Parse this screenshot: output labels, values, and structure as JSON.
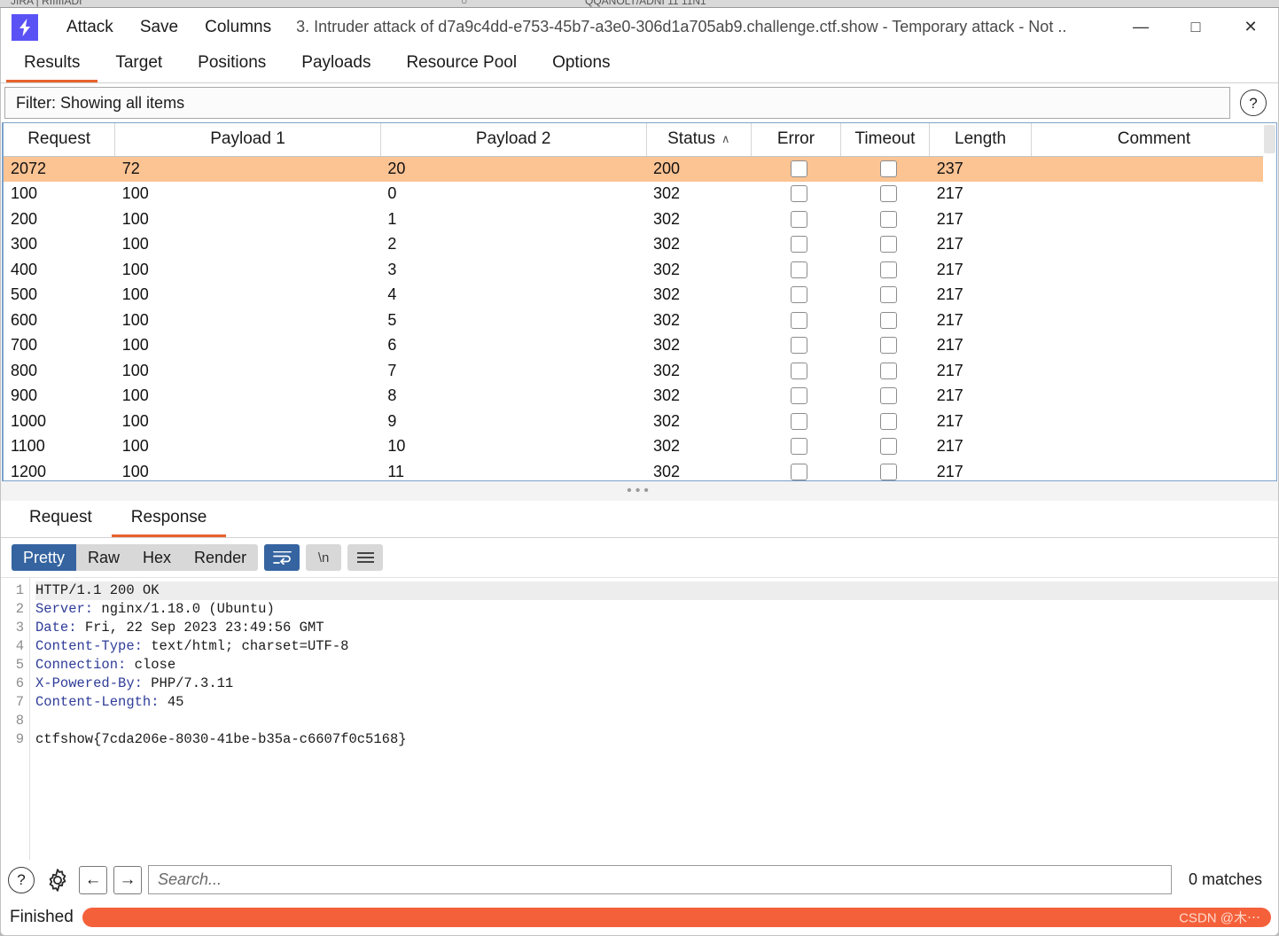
{
  "window": {
    "logo_icon": "lightning-bolt-icon",
    "title": "3. Intruder attack of d7a9c4dd-e753-45b7-a3e0-306d1a705ab9.challenge.ctf.show - Temporary attack - Not ..",
    "menu": [
      "Attack",
      "Save",
      "Columns"
    ],
    "controls": {
      "minimize": "—",
      "maximize": "□",
      "close": "✕"
    },
    "accent_orange": "#e8622c",
    "logo_color": "#5b52f5",
    "selected_row_color": "#fcc393",
    "progress_color": "#f4603a"
  },
  "top_tabs": [
    {
      "label": "Results",
      "active": true
    },
    {
      "label": "Target",
      "active": false
    },
    {
      "label": "Positions",
      "active": false
    },
    {
      "label": "Payloads",
      "active": false
    },
    {
      "label": "Resource Pool",
      "active": false
    },
    {
      "label": "Options",
      "active": false
    }
  ],
  "filter": {
    "text": "Filter: Showing all items",
    "help_icon": "question-mark-icon"
  },
  "results_table": {
    "columns": [
      "Request",
      "Payload 1",
      "Payload 2",
      "Status",
      "Error",
      "Timeout",
      "Length",
      "Comment"
    ],
    "sorted_column": "Status",
    "sort_direction": "ascending",
    "sort_glyph": "∧",
    "rows": [
      {
        "request": "2072",
        "payload1": "72",
        "payload2": "20",
        "status": "200",
        "error": false,
        "timeout": false,
        "length": "237",
        "comment": "",
        "selected": true
      },
      {
        "request": "100",
        "payload1": "100",
        "payload2": "0",
        "status": "302",
        "error": false,
        "timeout": false,
        "length": "217",
        "comment": "",
        "selected": false
      },
      {
        "request": "200",
        "payload1": "100",
        "payload2": "1",
        "status": "302",
        "error": false,
        "timeout": false,
        "length": "217",
        "comment": "",
        "selected": false
      },
      {
        "request": "300",
        "payload1": "100",
        "payload2": "2",
        "status": "302",
        "error": false,
        "timeout": false,
        "length": "217",
        "comment": "",
        "selected": false
      },
      {
        "request": "400",
        "payload1": "100",
        "payload2": "3",
        "status": "302",
        "error": false,
        "timeout": false,
        "length": "217",
        "comment": "",
        "selected": false
      },
      {
        "request": "500",
        "payload1": "100",
        "payload2": "4",
        "status": "302",
        "error": false,
        "timeout": false,
        "length": "217",
        "comment": "",
        "selected": false
      },
      {
        "request": "600",
        "payload1": "100",
        "payload2": "5",
        "status": "302",
        "error": false,
        "timeout": false,
        "length": "217",
        "comment": "",
        "selected": false
      },
      {
        "request": "700",
        "payload1": "100",
        "payload2": "6",
        "status": "302",
        "error": false,
        "timeout": false,
        "length": "217",
        "comment": "",
        "selected": false
      },
      {
        "request": "800",
        "payload1": "100",
        "payload2": "7",
        "status": "302",
        "error": false,
        "timeout": false,
        "length": "217",
        "comment": "",
        "selected": false
      },
      {
        "request": "900",
        "payload1": "100",
        "payload2": "8",
        "status": "302",
        "error": false,
        "timeout": false,
        "length": "217",
        "comment": "",
        "selected": false
      },
      {
        "request": "1000",
        "payload1": "100",
        "payload2": "9",
        "status": "302",
        "error": false,
        "timeout": false,
        "length": "217",
        "comment": "",
        "selected": false
      },
      {
        "request": "1100",
        "payload1": "100",
        "payload2": "10",
        "status": "302",
        "error": false,
        "timeout": false,
        "length": "217",
        "comment": "",
        "selected": false
      },
      {
        "request": "1200",
        "payload1": "100",
        "payload2": "11",
        "status": "302",
        "error": false,
        "timeout": false,
        "length": "217",
        "comment": "",
        "selected": false
      }
    ]
  },
  "message_tabs": [
    {
      "label": "Request",
      "active": false
    },
    {
      "label": "Response",
      "active": true
    }
  ],
  "editor_toolbar": {
    "views": [
      {
        "label": "Pretty",
        "active": true
      },
      {
        "label": "Raw",
        "active": false
      },
      {
        "label": "Hex",
        "active": false
      },
      {
        "label": "Render",
        "active": false
      }
    ],
    "wrap_icon": "word-wrap-icon",
    "newline_label": "\\n",
    "menu_icon": "hamburger-menu-icon"
  },
  "response": {
    "line_numbers": [
      "1",
      "2",
      "3",
      "4",
      "5",
      "6",
      "7",
      "8",
      "9"
    ],
    "lines": [
      {
        "n": "1",
        "type": "status",
        "text": "HTTP/1.1 200 OK"
      },
      {
        "n": "2",
        "type": "header",
        "key": "Server:",
        "value": " nginx/1.18.0 (Ubuntu)"
      },
      {
        "n": "3",
        "type": "header",
        "key": "Date:",
        "value": " Fri, 22 Sep 2023 23:49:56 GMT"
      },
      {
        "n": "4",
        "type": "header",
        "key": "Content-Type:",
        "value": " text/html; charset=UTF-8"
      },
      {
        "n": "5",
        "type": "header",
        "key": "Connection:",
        "value": " close"
      },
      {
        "n": "6",
        "type": "header",
        "key": "X-Powered-By:",
        "value": " PHP/7.3.11"
      },
      {
        "n": "7",
        "type": "header",
        "key": "Content-Length:",
        "value": " 45"
      },
      {
        "n": "8",
        "type": "blank",
        "text": ""
      },
      {
        "n": "9",
        "type": "body",
        "text": "ctfshow{7cda206e-8030-41be-b35a-c6607f0c5168}"
      }
    ]
  },
  "search": {
    "help_icon": "question-mark-icon",
    "settings_icon": "gear-icon",
    "prev_icon": "arrow-left-icon",
    "next_icon": "arrow-right-icon",
    "placeholder": "Search...",
    "value": "",
    "matches": "0 matches"
  },
  "status": {
    "text": "Finished",
    "progress_percent": 100,
    "watermark": "CSDN @木⋯"
  }
}
